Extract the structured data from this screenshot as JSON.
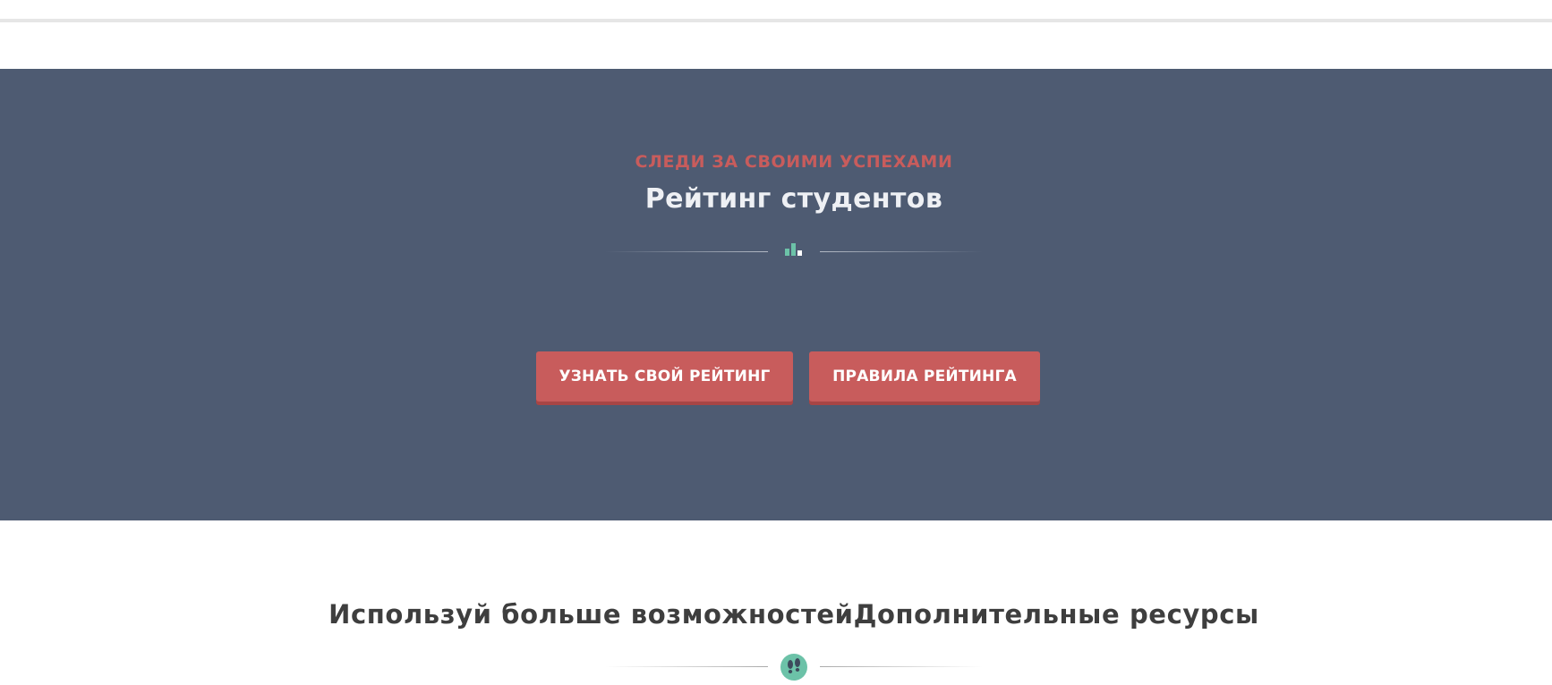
{
  "hero": {
    "kicker": "СЛЕДИ ЗА СВОИМИ УСПЕХАМИ",
    "title": "Рейтинг студентов",
    "divider_icon": "bar-chart-icon",
    "buttons": {
      "rating_label": "УЗНАТЬ СВОЙ РЕЙТИНГ",
      "rules_label": "ПРАВИЛА РЕЙТИНГА"
    }
  },
  "resources": {
    "title": "Используй больше возможностейДополнительные ресурсы",
    "divider_icon": "footprints-icon"
  },
  "colors": {
    "hero_bg": "#4e5b72",
    "accent": "#c85c5c",
    "icon_teal": "#6cc2a8"
  }
}
